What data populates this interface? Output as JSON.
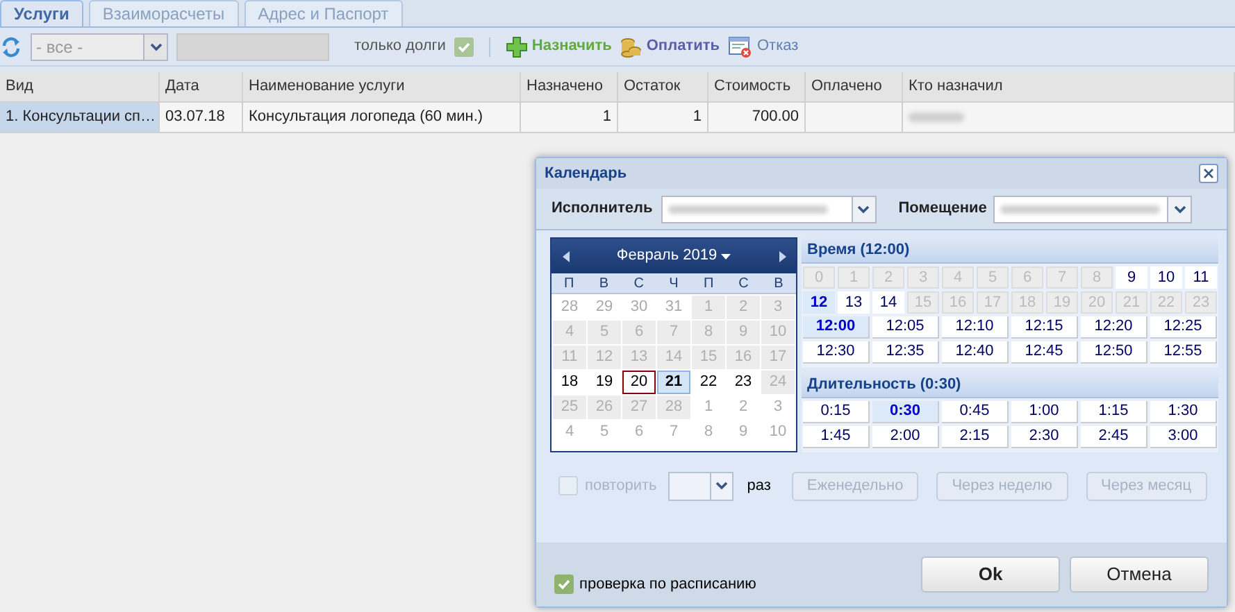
{
  "tabs": [
    {
      "label": "Услуги",
      "selected": true
    },
    {
      "label": "Взаиморасчеты",
      "selected": false
    },
    {
      "label": "Адрес и Паспорт",
      "selected": false
    }
  ],
  "toolbar": {
    "filter_select": {
      "value": "- все -"
    },
    "debts_only": {
      "label": "только долги",
      "checked": true,
      "disabled": true
    },
    "actions": [
      {
        "kind": "assign",
        "label": "Назначить"
      },
      {
        "kind": "pay",
        "label": "Оплатить"
      },
      {
        "kind": "refuse",
        "label": "Отказ"
      }
    ]
  },
  "table": {
    "columns": [
      "Вид",
      "Дата",
      "Наименование услуги",
      "Назначено",
      "Остаток",
      "Стоимость",
      "Оплачено",
      "Кто назначил"
    ],
    "rows": [
      {
        "cells": [
          {
            "text": "1. Консультации сп…",
            "selected": true
          },
          {
            "text": "03.07.18",
            "selected": false
          },
          {
            "text": "Консультация логопеда (60 мин.)",
            "selected": false
          },
          {
            "text": "1",
            "selected": false
          },
          {
            "text": "1",
            "selected": false
          },
          {
            "text": "700.00",
            "selected": false
          }
        ]
      }
    ]
  },
  "dialog": {
    "title": "Календарь",
    "performer": {
      "label": "Исполнитель"
    },
    "room": {
      "label": "Помещение"
    },
    "calendar": {
      "month": "Февраль 2019",
      "weekdays": [
        "П",
        "В",
        "С",
        "Ч",
        "П",
        "С",
        "В"
      ],
      "days": [
        {
          "label": "28",
          "kind": "outside",
          "selected": false
        },
        {
          "label": "29",
          "kind": "outside",
          "selected": false
        },
        {
          "label": "30",
          "kind": "outside",
          "selected": false
        },
        {
          "label": "31",
          "kind": "outside",
          "selected": false
        },
        {
          "label": "1",
          "kind": "disabled",
          "selected": false
        },
        {
          "label": "2",
          "kind": "disabled",
          "selected": false
        },
        {
          "label": "3",
          "kind": "disabled",
          "selected": false
        },
        {
          "label": "4",
          "kind": "disabled",
          "selected": false
        },
        {
          "label": "5",
          "kind": "disabled",
          "selected": false
        },
        {
          "label": "6",
          "kind": "disabled",
          "selected": false
        },
        {
          "label": "7",
          "kind": "disabled",
          "selected": false
        },
        {
          "label": "8",
          "kind": "disabled",
          "selected": false
        },
        {
          "label": "9",
          "kind": "disabled",
          "selected": false
        },
        {
          "label": "10",
          "kind": "disabled",
          "selected": false
        },
        {
          "label": "11",
          "kind": "disabled",
          "selected": false
        },
        {
          "label": "12",
          "kind": "disabled",
          "selected": false
        },
        {
          "label": "13",
          "kind": "disabled",
          "selected": false
        },
        {
          "label": "14",
          "kind": "disabled",
          "selected": false
        },
        {
          "label": "15",
          "kind": "disabled",
          "selected": false
        },
        {
          "label": "16",
          "kind": "disabled",
          "selected": false
        },
        {
          "label": "17",
          "kind": "disabled",
          "selected": false
        },
        {
          "label": "18",
          "kind": "available",
          "selected": false
        },
        {
          "label": "19",
          "kind": "available",
          "selected": false
        },
        {
          "label": "20",
          "kind": "today",
          "selected": false
        },
        {
          "label": "21",
          "kind": "available",
          "selected": true
        },
        {
          "label": "22",
          "kind": "available",
          "selected": false
        },
        {
          "label": "23",
          "kind": "available",
          "selected": false
        },
        {
          "label": "24",
          "kind": "disabled",
          "selected": false
        },
        {
          "label": "25",
          "kind": "disabled",
          "selected": false
        },
        {
          "label": "26",
          "kind": "disabled",
          "selected": false
        },
        {
          "label": "27",
          "kind": "disabled",
          "selected": false
        },
        {
          "label": "28",
          "kind": "disabled",
          "selected": false
        },
        {
          "label": "1",
          "kind": "outside",
          "selected": false
        },
        {
          "label": "2",
          "kind": "outside",
          "selected": false
        },
        {
          "label": "3",
          "kind": "outside",
          "selected": false
        },
        {
          "label": "4",
          "kind": "outside",
          "selected": false
        },
        {
          "label": "5",
          "kind": "outside",
          "selected": false
        },
        {
          "label": "6",
          "kind": "outside",
          "selected": false
        },
        {
          "label": "7",
          "kind": "outside",
          "selected": false
        },
        {
          "label": "8",
          "kind": "outside",
          "selected": false
        },
        {
          "label": "9",
          "kind": "outside",
          "selected": false
        },
        {
          "label": "10",
          "kind": "outside",
          "selected": false
        }
      ]
    },
    "time": {
      "title": "Время (12:00)",
      "hours": [
        {
          "label": "0",
          "disabled": true,
          "selected": false
        },
        {
          "label": "1",
          "disabled": true,
          "selected": false
        },
        {
          "label": "2",
          "disabled": true,
          "selected": false
        },
        {
          "label": "3",
          "disabled": true,
          "selected": false
        },
        {
          "label": "4",
          "disabled": true,
          "selected": false
        },
        {
          "label": "5",
          "disabled": true,
          "selected": false
        },
        {
          "label": "6",
          "disabled": true,
          "selected": false
        },
        {
          "label": "7",
          "disabled": true,
          "selected": false
        },
        {
          "label": "8",
          "disabled": true,
          "selected": false
        },
        {
          "label": "9",
          "disabled": false,
          "selected": false
        },
        {
          "label": "10",
          "disabled": false,
          "selected": false
        },
        {
          "label": "11",
          "disabled": false,
          "selected": false
        },
        {
          "label": "12",
          "disabled": false,
          "selected": true
        },
        {
          "label": "13",
          "disabled": false,
          "selected": false
        },
        {
          "label": "14",
          "disabled": false,
          "selected": false
        },
        {
          "label": "15",
          "disabled": true,
          "selected": false
        },
        {
          "label": "16",
          "disabled": true,
          "selected": false
        },
        {
          "label": "17",
          "disabled": true,
          "selected": false
        },
        {
          "label": "18",
          "disabled": true,
          "selected": false
        },
        {
          "label": "19",
          "disabled": true,
          "selected": false
        },
        {
          "label": "20",
          "disabled": true,
          "selected": false
        },
        {
          "label": "21",
          "disabled": true,
          "selected": false
        },
        {
          "label": "22",
          "disabled": true,
          "selected": false
        },
        {
          "label": "23",
          "disabled": true,
          "selected": false
        }
      ],
      "minutes": [
        {
          "label": "12:00",
          "selected": true
        },
        {
          "label": "12:05",
          "selected": false
        },
        {
          "label": "12:10",
          "selected": false
        },
        {
          "label": "12:15",
          "selected": false
        },
        {
          "label": "12:20",
          "selected": false
        },
        {
          "label": "12:25",
          "selected": false
        },
        {
          "label": "12:30",
          "selected": false
        },
        {
          "label": "12:35",
          "selected": false
        },
        {
          "label": "12:40",
          "selected": false
        },
        {
          "label": "12:45",
          "selected": false
        },
        {
          "label": "12:50",
          "selected": false
        },
        {
          "label": "12:55",
          "selected": false
        }
      ]
    },
    "duration": {
      "title": "Длительность (0:30)",
      "options": [
        {
          "label": "0:15",
          "selected": false
        },
        {
          "label": "0:30",
          "selected": true
        },
        {
          "label": "0:45",
          "selected": false
        },
        {
          "label": "1:00",
          "selected": false
        },
        {
          "label": "1:15",
          "selected": false
        },
        {
          "label": "1:30",
          "selected": false
        },
        {
          "label": "1:45",
          "selected": false
        },
        {
          "label": "2:00",
          "selected": false
        },
        {
          "label": "2:15",
          "selected": false
        },
        {
          "label": "2:30",
          "selected": false
        },
        {
          "label": "2:45",
          "selected": false
        },
        {
          "label": "3:00",
          "selected": false
        }
      ]
    },
    "repeat": {
      "label": "повторить",
      "checked": false,
      "disabled": true,
      "times_label": "раз",
      "buttons": [
        {
          "label": "Еженедельно",
          "disabled": true
        },
        {
          "label": "Через неделю",
          "disabled": true
        },
        {
          "label": "Через месяц",
          "disabled": true
        }
      ]
    },
    "schedule_check": {
      "label": "проверка по расписанию",
      "checked": true
    },
    "buttons": [
      "Ok",
      "Отмена"
    ]
  }
}
